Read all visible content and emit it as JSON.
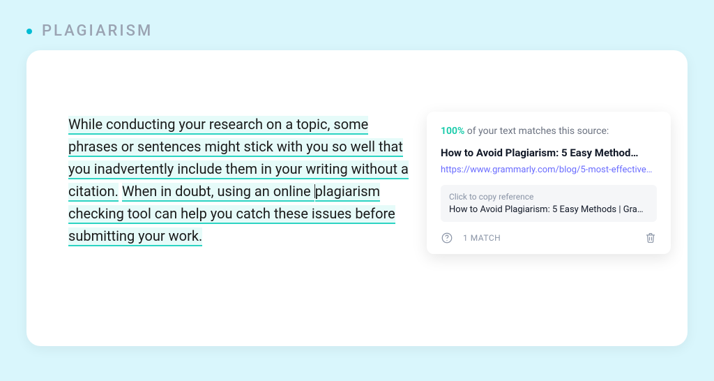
{
  "header": {
    "title": "PLAGIARISM"
  },
  "editor": {
    "segments": [
      "While conducting your research on a topic, some",
      "phrases or sentences might stick with you so well that",
      "you inadvertently include them in your writing without a",
      "citation.",
      "When in doubt, using an online ",
      "plagiarism",
      "checking tool can help you catch these issues before",
      "submitting your work."
    ]
  },
  "card": {
    "percent": "100%",
    "match_line_suffix": " of your text matches this source:",
    "source_title": "How to Avoid Plagiarism: 5 Easy Method…",
    "source_url": "https://www.grammarly.com/blog/5-most-effective…",
    "reference": {
      "label": "Click to copy reference",
      "text": "How to Avoid Plagiarism: 5 Easy Methods | Gram…"
    },
    "match_count_label": "1 MATCH"
  }
}
